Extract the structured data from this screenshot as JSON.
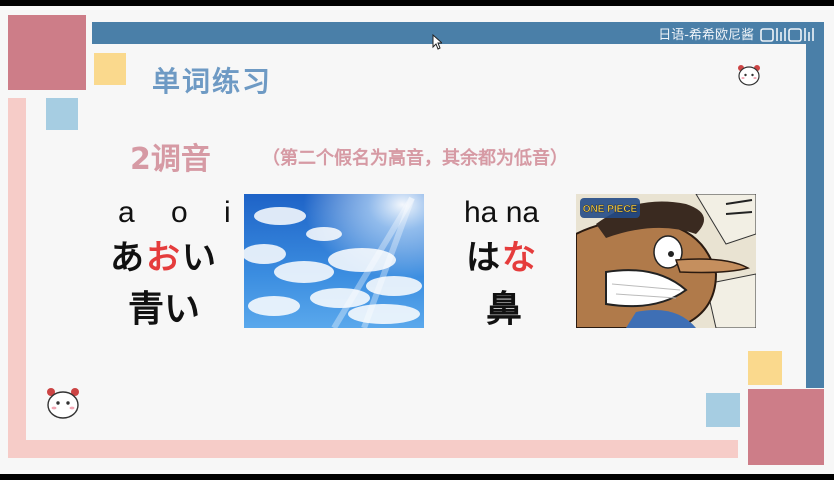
{
  "watermark": {
    "text": "日语-希希欧尼酱",
    "logo": "bilibili"
  },
  "slide": {
    "title": "单词练习",
    "heading": "2调音",
    "note": "（第二个假名为高音，其余都为低音）"
  },
  "words": [
    {
      "romaji": "a o i",
      "kana_before": "あ",
      "kana_accent": "お",
      "kana_after": "い",
      "kanji": "青い",
      "image_icon": "blue-sky-image"
    },
    {
      "romaji": "ha na",
      "kana_before": "は",
      "kana_accent": "な",
      "kana_after": "",
      "kanji": "鼻",
      "image_icon": "one-piece-usopp-image",
      "image_logo_text": "ONE PIECE"
    }
  ],
  "colors": {
    "title": "#6e9ac4",
    "heading": "#d69aa4",
    "accent": "#e53c3c",
    "frame_blue": "#4a7fa8",
    "frame_pink": "#f6ccc8",
    "rose": "#cd7d88",
    "yellow": "#fad98d",
    "light_blue": "#a6cde2"
  }
}
